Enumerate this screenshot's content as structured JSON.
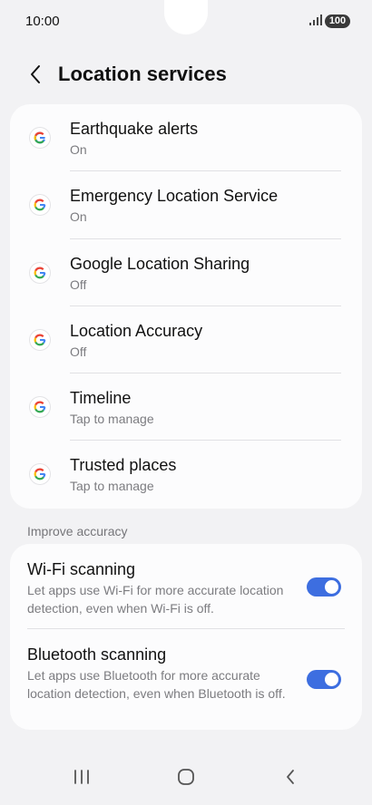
{
  "status_bar": {
    "time": "10:00",
    "battery": "100",
    "signal_icon": "signal-icon"
  },
  "header": {
    "title": "Location services",
    "back_icon": "chevron-left-icon"
  },
  "google_services": [
    {
      "title": "Earthquake alerts",
      "subtitle": "On",
      "icon": "google-icon"
    },
    {
      "title": "Emergency Location Service",
      "subtitle": "On",
      "icon": "google-icon"
    },
    {
      "title": "Google Location Sharing",
      "subtitle": "Off",
      "icon": "google-icon"
    },
    {
      "title": "Location Accuracy",
      "subtitle": "Off",
      "icon": "google-icon"
    },
    {
      "title": "Timeline",
      "subtitle": "Tap to manage",
      "icon": "google-icon"
    },
    {
      "title": "Trusted places",
      "subtitle": "Tap to manage",
      "icon": "google-icon"
    }
  ],
  "improve_accuracy": {
    "header": "Improve accuracy",
    "items": [
      {
        "title": "Wi-Fi scanning",
        "description": "Let apps use Wi-Fi for more accurate location detection, even when Wi-Fi is off.",
        "enabled": true
      },
      {
        "title": "Bluetooth scanning",
        "description": "Let apps use Bluetooth for more accurate location detection, even when Bluetooth is off.",
        "enabled": true
      }
    ]
  },
  "nav_bar": {
    "recents_icon": "recents-icon",
    "home_icon": "home-icon",
    "back_icon": "back-icon"
  },
  "colors": {
    "accent": "#3d6ee0",
    "background": "#f2f2f4",
    "card": "#fcfcfd",
    "subtext": "#7c7c80"
  }
}
